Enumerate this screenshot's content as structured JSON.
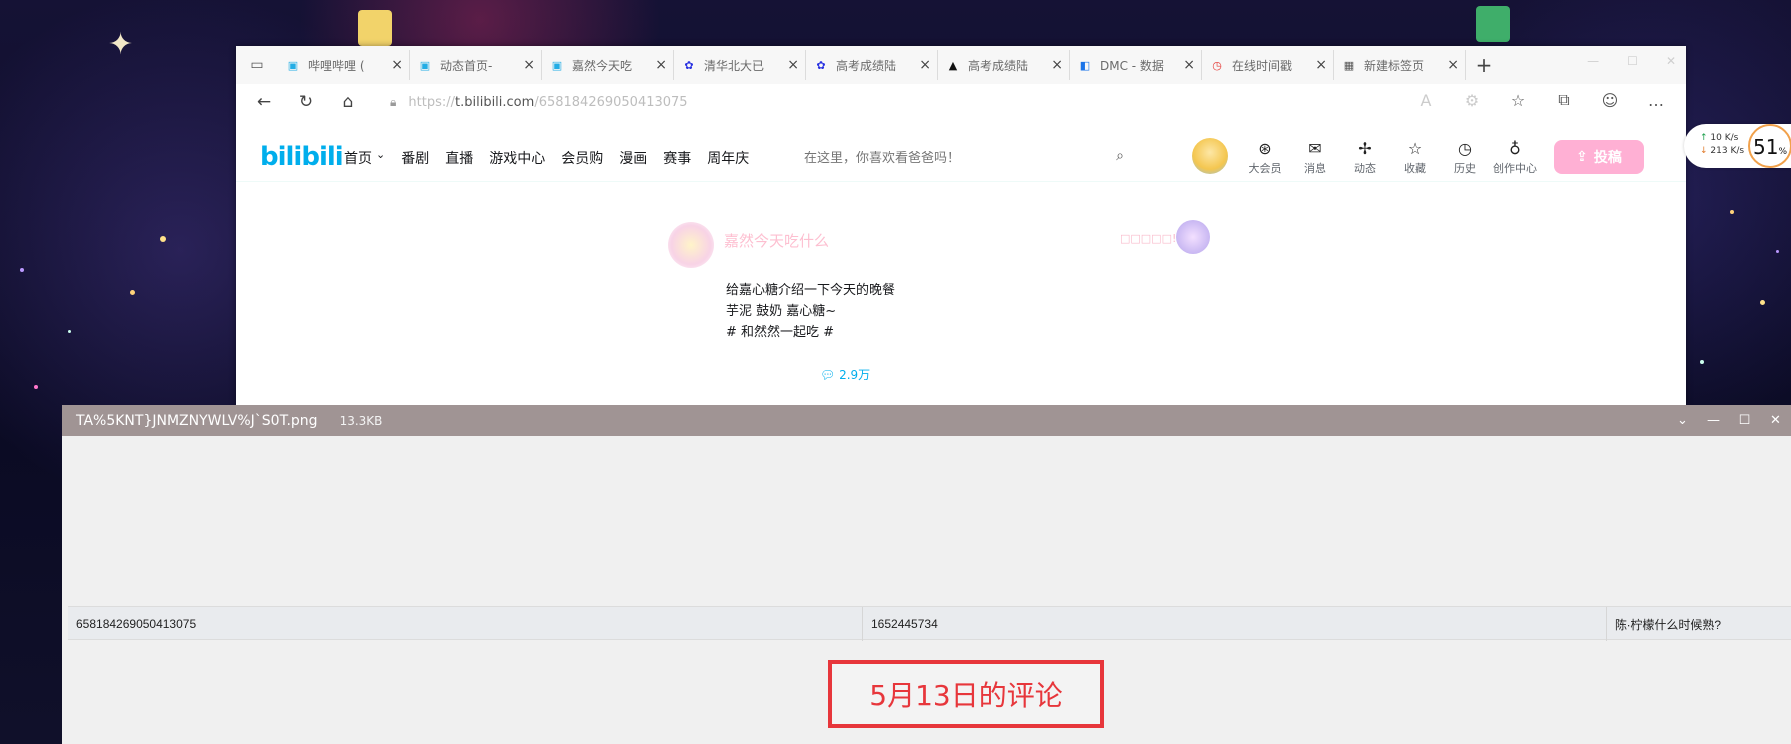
{
  "browser": {
    "tabs": [
      {
        "title": "哔哩哔哩 (",
        "favicon": "bilibili-icon"
      },
      {
        "title": "动态首页-",
        "favicon": "bilibili-icon"
      },
      {
        "title": "嘉然今天吃",
        "favicon": "bilibili-icon"
      },
      {
        "title": "清华北大已",
        "favicon": "baidu-paw-icon"
      },
      {
        "title": "高考成绩陆",
        "favicon": "baidu-paw-icon"
      },
      {
        "title": "高考成绩陆",
        "favicon": "zhihu-icon"
      },
      {
        "title": "DMC - 数据",
        "favicon": "dmc-icon"
      },
      {
        "title": "在线时间戳",
        "favicon": "clock-icon"
      },
      {
        "title": "新建标签页",
        "favicon": "newtab-icon"
      }
    ],
    "url": {
      "prefix": "https://",
      "host": "t.bilibili.com",
      "path": "/658184269050413075"
    }
  },
  "bilibili": {
    "logo": "bilibili",
    "nav": [
      "首页",
      "番剧",
      "直播",
      "游戏中心",
      "会员购",
      "漫画",
      "赛事",
      "周年庆"
    ],
    "search_placeholder": "在这里，你喜欢看爸爸吗！",
    "header_icons": [
      {
        "label": "大会员",
        "icon": "vip-icon"
      },
      {
        "label": "消息",
        "icon": "message-icon"
      },
      {
        "label": "动态",
        "icon": "fan-icon"
      },
      {
        "label": "收藏",
        "icon": "star-icon"
      },
      {
        "label": "历史",
        "icon": "history-icon"
      },
      {
        "label": "创作中心",
        "icon": "bulb-icon"
      }
    ],
    "upload_label": "投稿",
    "post": {
      "author": "嘉然今天吃什么",
      "right_text": "□□□□□!",
      "lines": [
        "给嘉心糖介绍一下今天的晚餐",
        "芋泥 鼓奶 嘉心糖~",
        "# 和然然一起吃 #"
      ],
      "comment_count": "2.9万"
    }
  },
  "viewer": {
    "filename": "TA%5KNT}JNMZNYWLV%J`S0T.png",
    "filesize": "13.3KB",
    "row": [
      "658184269050413075",
      "1652445734",
      "陈∙柠檬什么时候熟?"
    ],
    "annotation": "5月13日的评论"
  },
  "net_widget": {
    "up": "10 K/s",
    "down": "213 K/s",
    "percent": "51",
    "percent_unit": "%"
  }
}
